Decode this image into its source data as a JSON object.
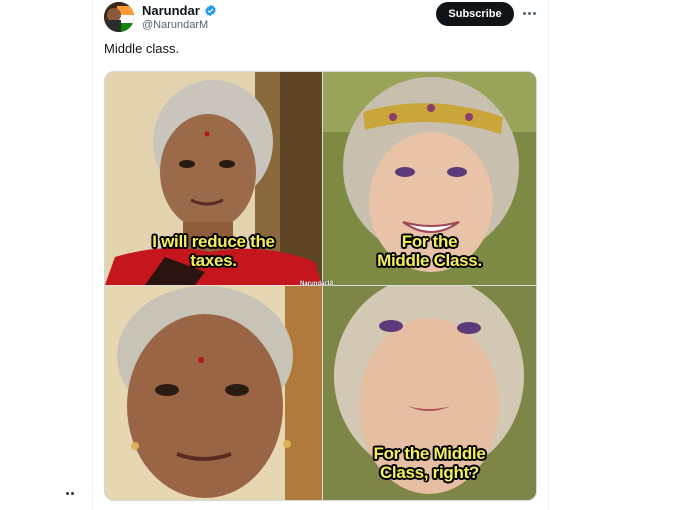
{
  "tweet": {
    "display_name": "Narundar",
    "handle": "@NarundarM",
    "verified_icon": "verified-badge-icon",
    "subscribe_label": "Subscribe",
    "more_icon": "more-options-icon",
    "text": "Middle class."
  },
  "meme": {
    "panel_top_left_caption": "I will reduce the taxes.",
    "panel_top_right_caption": "For the Middle Class.",
    "panel_bottom_left_caption": "",
    "panel_bottom_right_caption": "For the Middle Class, right?",
    "watermark": "Narundar18"
  },
  "colors": {
    "caption_fill": "#f4ee5a",
    "subscribe_bg": "#0f1419",
    "verified_blue": "#1d9bf0"
  }
}
